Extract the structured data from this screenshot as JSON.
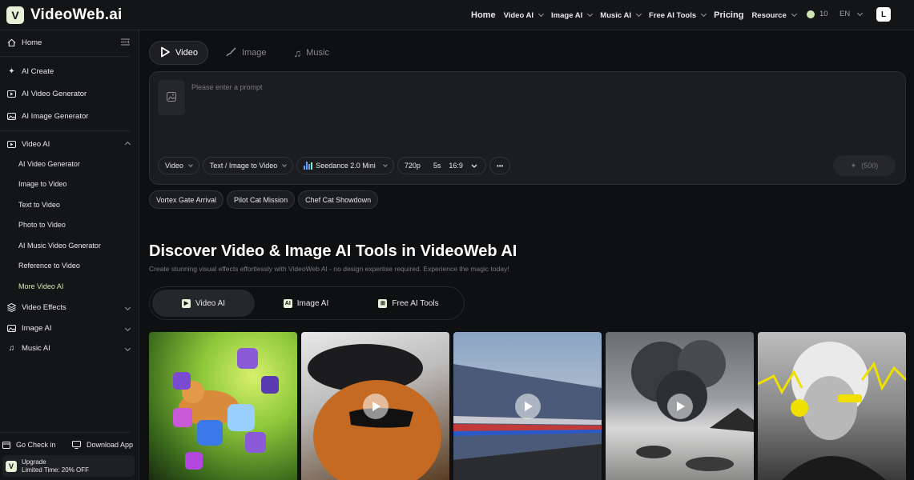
{
  "brand": {
    "name": "VideoWeb.ai"
  },
  "topnav": {
    "home": "Home",
    "video_ai": "Video AI",
    "image_ai": "Image AI",
    "music_ai": "Music AI",
    "free_ai_tools": "Free AI Tools",
    "pricing": "Pricing",
    "resource": "Resource",
    "credits": "10",
    "lang": "EN",
    "avatar": "L"
  },
  "sidebar": {
    "home": "Home",
    "ai_create": "AI Create",
    "ai_video_generator": "AI Video Generator",
    "ai_image_generator": "AI Image Generator",
    "video_ai": {
      "label": "Video AI",
      "items": [
        "AI Video Generator",
        "Image to Video",
        "Text to Video",
        "Photo to Video",
        "AI Music Video Generator",
        "Reference to Video",
        "More Video AI"
      ]
    },
    "video_effects": "Video Effects",
    "image_ai": "Image AI",
    "music_ai": "Music AI",
    "go_check_in": "Go Check in",
    "download_app": "Download App",
    "upgrade_title": "Upgrade",
    "upgrade_sub": "Limited Time: 20% OFF"
  },
  "mode_tabs": [
    "Video",
    "Image",
    "Music"
  ],
  "prompt": {
    "placeholder": "Please enter a prompt",
    "type": "Video",
    "mode": "Text / Image to Video",
    "model": "Seedance 2.0 Mini",
    "resolution": "720p",
    "duration": "5s",
    "ratio": "16:9",
    "more": "•••",
    "generate_cost": "(500)"
  },
  "suggestions": [
    "Vortex Gate Arrival",
    "Pilot Cat Mission",
    "Chef Cat Showdown"
  ],
  "discover": {
    "title": "Discover Video & Image AI Tools in VideoWeb AI",
    "subtitle": "Create stunning visual effects effortlessly with VideoWeb AI - no design expertise required. Experience the magic today!",
    "tabs": [
      "Video AI",
      "Image AI",
      "Free AI Tools"
    ]
  },
  "colors": {
    "accent": "#e9f0d8",
    "model_icon": "#5aa6ff"
  }
}
